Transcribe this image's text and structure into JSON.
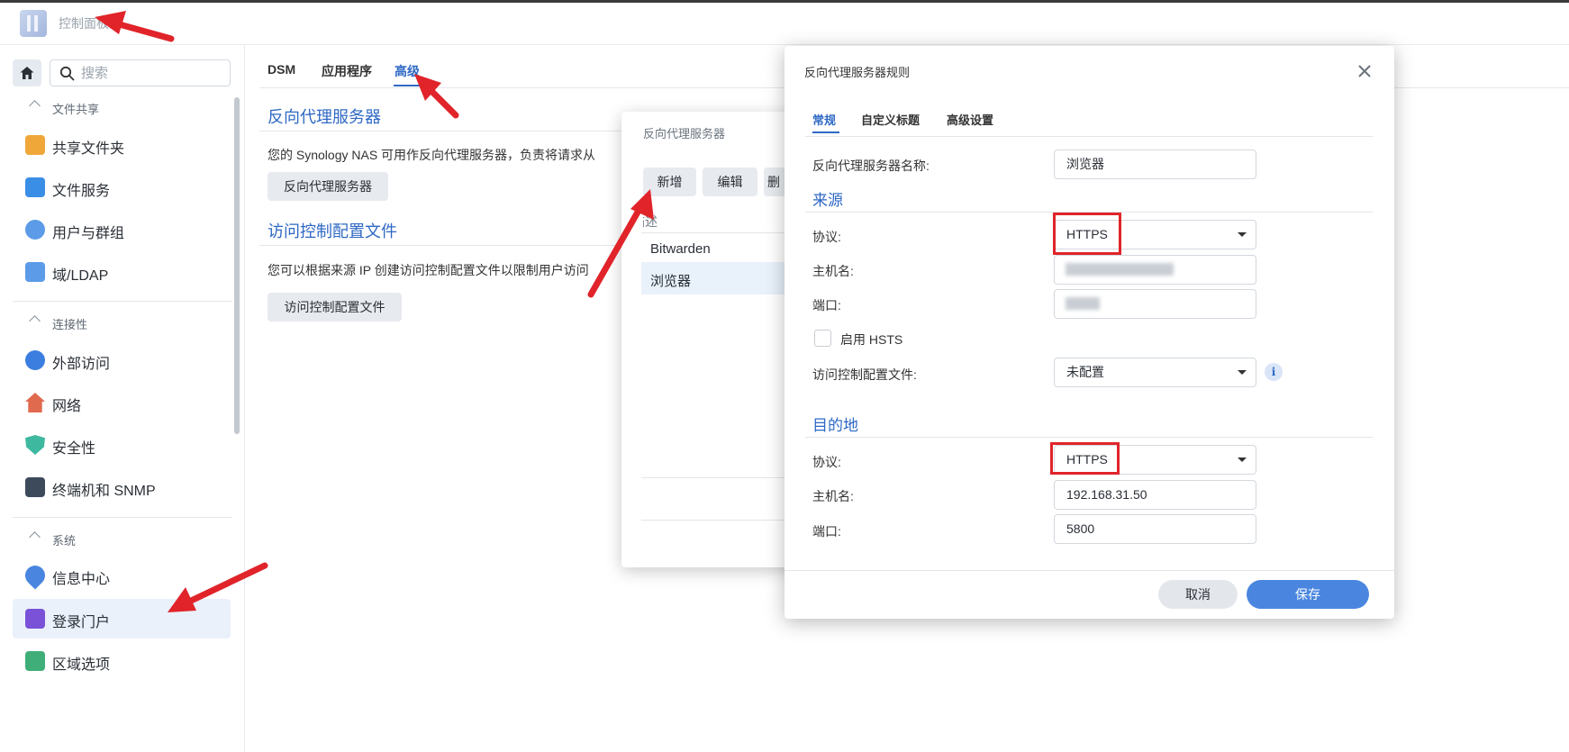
{
  "app": {
    "title": "控制面板"
  },
  "sidebar": {
    "search_placeholder": "搜索",
    "sections": [
      {
        "title": "文件共享",
        "items": [
          {
            "label": "共享文件夹",
            "icon": "shared-folder-icon",
            "color": "#f0a73a"
          },
          {
            "label": "文件服务",
            "icon": "file-services-icon",
            "color": "#3a8ee6"
          },
          {
            "label": "用户与群组",
            "icon": "users-groups-icon",
            "color": "#5b9be8"
          },
          {
            "label": "域/LDAP",
            "icon": "domain-ldap-icon",
            "color": "#5b9be8"
          }
        ]
      },
      {
        "title": "连接性",
        "items": [
          {
            "label": "外部访问",
            "icon": "external-access-icon",
            "color": "#3b7ee0"
          },
          {
            "label": "网络",
            "icon": "network-icon",
            "color": "#e06a4e"
          },
          {
            "label": "安全性",
            "icon": "security-icon",
            "color": "#3fb8a0"
          },
          {
            "label": "终端机和 SNMP",
            "icon": "terminal-snmp-icon",
            "color": "#3d4a5c"
          }
        ]
      },
      {
        "title": "系统",
        "items": [
          {
            "label": "信息中心",
            "icon": "info-center-icon",
            "color": "#4a86e0"
          },
          {
            "label": "登录门户",
            "icon": "login-portal-icon",
            "color": "#7a52d8"
          },
          {
            "label": "区域选项",
            "icon": "regional-options-icon",
            "color": "#3fae78"
          }
        ]
      }
    ]
  },
  "tabs": [
    "DSM",
    "应用程序",
    "高级"
  ],
  "main": {
    "reverse_proxy_title": "反向代理服务器",
    "reverse_proxy_desc": "您的 Synology NAS 可用作反向代理服务器，负责将请求从",
    "reverse_proxy_button": "反向代理服务器",
    "access_profile_title": "访问控制配置文件",
    "access_profile_desc": "您可以根据来源 IP 创建访问控制配置文件以限制用户访问",
    "access_profile_button": "访问控制配置文件"
  },
  "proxy_dialog": {
    "title": "反向代理服务器",
    "buttons": [
      "新增",
      "编辑",
      "删"
    ],
    "column_header": "描述",
    "rows": [
      "Bitwarden",
      "浏览器"
    ]
  },
  "rule_dialog": {
    "title": "反向代理服务器规则",
    "tabs": [
      "常规",
      "自定义标题",
      "高级设置"
    ],
    "name_label": "反向代理服务器名称:",
    "name_value": "浏览器",
    "source_title": "来源",
    "source": {
      "protocol_label": "协议:",
      "protocol_value": "HTTPS",
      "hostname_label": "主机名:",
      "port_label": "端口:",
      "hsts_label": "启用 HSTS",
      "acl_label": "访问控制配置文件:",
      "acl_value": "未配置"
    },
    "dest_title": "目的地",
    "destination": {
      "protocol_label": "协议:",
      "protocol_value": "HTTPS",
      "hostname_label": "主机名:",
      "hostname_value": "192.168.31.50",
      "port_label": "端口:",
      "port_value": "5800"
    },
    "cancel": "取消",
    "save": "保存"
  },
  "colors": {
    "accent": "#2e68c4",
    "primary_button": "#4a86e0",
    "annotation": "#e0242a"
  }
}
